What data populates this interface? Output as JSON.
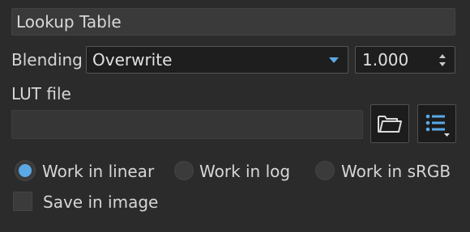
{
  "module": {
    "title": "Lookup Table"
  },
  "blending": {
    "label": "Blending",
    "mode": "Overwrite",
    "opacity": "1.000"
  },
  "lut": {
    "label": "LUT file",
    "value": "",
    "open_icon": "folder-open-icon",
    "list_icon": "list-menu-icon"
  },
  "work_space": {
    "options": [
      "Work in linear",
      "Work in log",
      "Work in sRGB"
    ],
    "selected": "Work in linear"
  },
  "save_in_image": {
    "label": "Save in image",
    "checked": false
  },
  "colors": {
    "accent": "#5aa9e6",
    "background": "#2b2b2b"
  }
}
